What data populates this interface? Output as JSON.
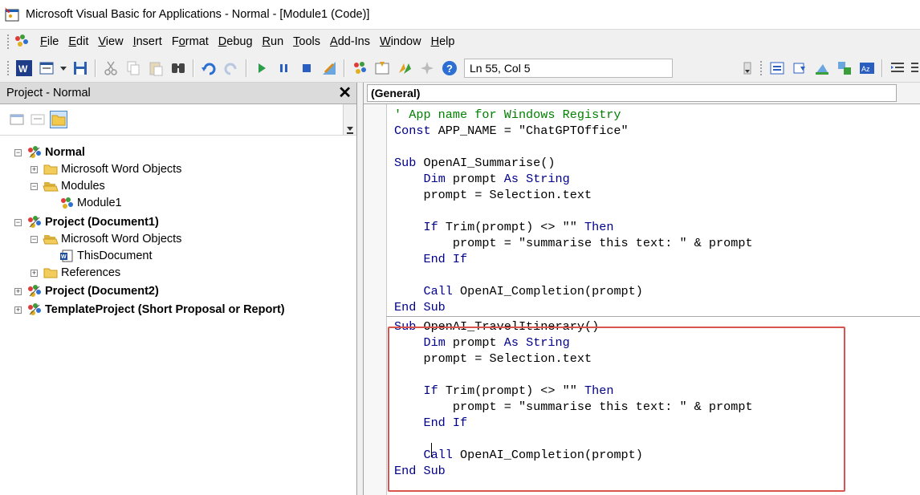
{
  "window": {
    "title": "Microsoft Visual Basic for Applications - Normal - [Module1 (Code)]"
  },
  "menu": [
    {
      "label": "File",
      "u": "F",
      "rest": "ile"
    },
    {
      "label": "Edit",
      "u": "E",
      "rest": "dit"
    },
    {
      "label": "View",
      "u": "V",
      "rest": "iew"
    },
    {
      "label": "Insert",
      "u": "I",
      "rest": "nsert"
    },
    {
      "label": "Format",
      "pre": "F",
      "u": "o",
      "rest": "rmat"
    },
    {
      "label": "Debug",
      "u": "D",
      "rest": "ebug"
    },
    {
      "label": "Run",
      "u": "R",
      "rest": "un"
    },
    {
      "label": "Tools",
      "u": "T",
      "rest": "ools"
    },
    {
      "label": "Add-Ins",
      "u": "A",
      "rest": "dd-Ins"
    },
    {
      "label": "Window",
      "u": "W",
      "rest": "indow"
    },
    {
      "label": "Help",
      "u": "H",
      "rest": "elp"
    }
  ],
  "toolbar": {
    "position": "Ln 55, Col 5"
  },
  "project_pane": {
    "title": "Project - Normal",
    "tree": [
      {
        "label": "Normal",
        "level": 0,
        "bold": true,
        "exp": "-",
        "icon": "vba-project-icon"
      },
      {
        "label": "Microsoft Word Objects",
        "level": 1,
        "bold": false,
        "exp": "+",
        "icon": "folder-icon"
      },
      {
        "label": "Modules",
        "level": 1,
        "bold": false,
        "exp": "-",
        "icon": "open-folder-icon"
      },
      {
        "label": "Module1",
        "level": 2,
        "bold": false,
        "exp": "",
        "icon": "module-icon"
      },
      {
        "label": "Project (Document1)",
        "level": 0,
        "bold": true,
        "exp": "-",
        "icon": "vba-project-icon"
      },
      {
        "label": "Microsoft Word Objects",
        "level": 1,
        "bold": false,
        "exp": "-",
        "icon": "open-folder-icon"
      },
      {
        "label": "ThisDocument",
        "level": 2,
        "bold": false,
        "exp": "",
        "icon": "word-document-icon"
      },
      {
        "label": "References",
        "level": 1,
        "bold": false,
        "exp": "+",
        "icon": "folder-icon"
      },
      {
        "label": "Project (Document2)",
        "level": 0,
        "bold": true,
        "exp": "+",
        "icon": "vba-project-icon"
      },
      {
        "label": "TemplateProject (Short Proposal or Report)",
        "level": 0,
        "bold": true,
        "exp": "+",
        "icon": "vba-project-icon"
      }
    ]
  },
  "code_pane": {
    "object_combo": "(General)",
    "lines": [
      {
        "t": "' App name for Windows Registry",
        "k": "cm"
      },
      {
        "t": "Const APP_NAME = \"ChatGPTOffice\"",
        "k": "mixed1"
      },
      {
        "t": "",
        "k": ""
      },
      {
        "t": "Sub OpenAI_Summarise()",
        "k": "sub"
      },
      {
        "t": "    Dim prompt As String",
        "k": "dim"
      },
      {
        "t": "    prompt = Selection.text",
        "k": ""
      },
      {
        "t": "",
        "k": ""
      },
      {
        "t": "    If Trim(prompt) <> \"\" Then",
        "k": "if"
      },
      {
        "t": "        prompt = \"summarise this text: \" & prompt",
        "k": ""
      },
      {
        "t": "    End If",
        "k": "kwline"
      },
      {
        "t": "",
        "k": ""
      },
      {
        "t": "    Call OpenAI_Completion(prompt)",
        "k": "call"
      },
      {
        "t": "End Sub",
        "k": "kwline"
      },
      {
        "t": "---",
        "k": "sep"
      },
      {
        "t": "Sub OpenAI_TravelItinerary()",
        "k": "sub"
      },
      {
        "t": "    Dim prompt As String",
        "k": "dim"
      },
      {
        "t": "    prompt = Selection.text",
        "k": ""
      },
      {
        "t": "",
        "k": ""
      },
      {
        "t": "    If Trim(prompt) <> \"\" Then",
        "k": "if"
      },
      {
        "t": "        prompt = \"summarise this text: \" & prompt",
        "k": ""
      },
      {
        "t": "    End If",
        "k": "kwline"
      },
      {
        "t": "",
        "k": ""
      },
      {
        "t": "    Call OpenAI_Completion(prompt)",
        "k": "call"
      },
      {
        "t": "End Sub",
        "k": "kwline"
      }
    ]
  },
  "colors": {
    "keyword": "#00008b",
    "comment": "#008000",
    "highlight_border": "#d9534f"
  }
}
